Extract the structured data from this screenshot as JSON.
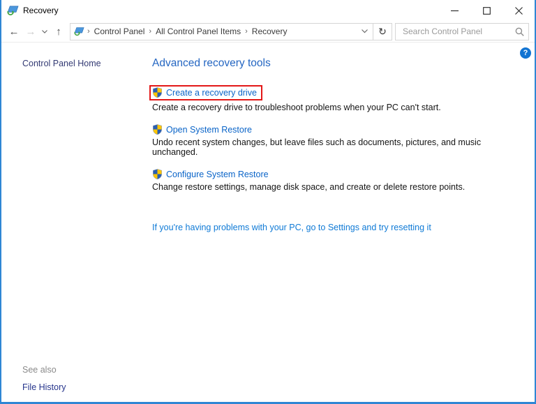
{
  "window": {
    "title": "Recovery"
  },
  "navbar": {
    "breadcrumb": {
      "items": [
        "Control Panel",
        "All Control Panel Items",
        "Recovery"
      ],
      "separator": "›"
    },
    "search": {
      "placeholder": "Search Control Panel"
    }
  },
  "icons": {
    "back": "←",
    "forward": "→",
    "up": "↑",
    "refresh": "↻",
    "help": "?"
  },
  "sidebar": {
    "home_label": "Control Panel Home",
    "see_also_label": "See also",
    "file_history_label": "File History"
  },
  "main": {
    "heading": "Advanced recovery tools",
    "tasks": [
      {
        "label": "Create a recovery drive",
        "description": "Create a recovery drive to troubleshoot problems when your PC can't start.",
        "highlighted": true
      },
      {
        "label": "Open System Restore",
        "description": "Undo recent system changes, but leave files such as documents, pictures, and music unchanged.",
        "highlighted": false
      },
      {
        "label": "Configure System Restore",
        "description": "Change restore settings, manage disk space, and create or delete restore points.",
        "highlighted": false
      }
    ],
    "settings_link": "If you're having problems with your PC, go to Settings and try resetting it"
  },
  "colors": {
    "window_border": "#2f86d4",
    "heading_blue": "#2466c2",
    "task_link_blue": "#0a64c8",
    "settings_link_blue": "#0f7ad6",
    "sidebar_navy": "#333a73",
    "highlight_red": "#e31717",
    "shield_blue": "#2b5fb0",
    "shield_yellow": "#fdc500"
  }
}
